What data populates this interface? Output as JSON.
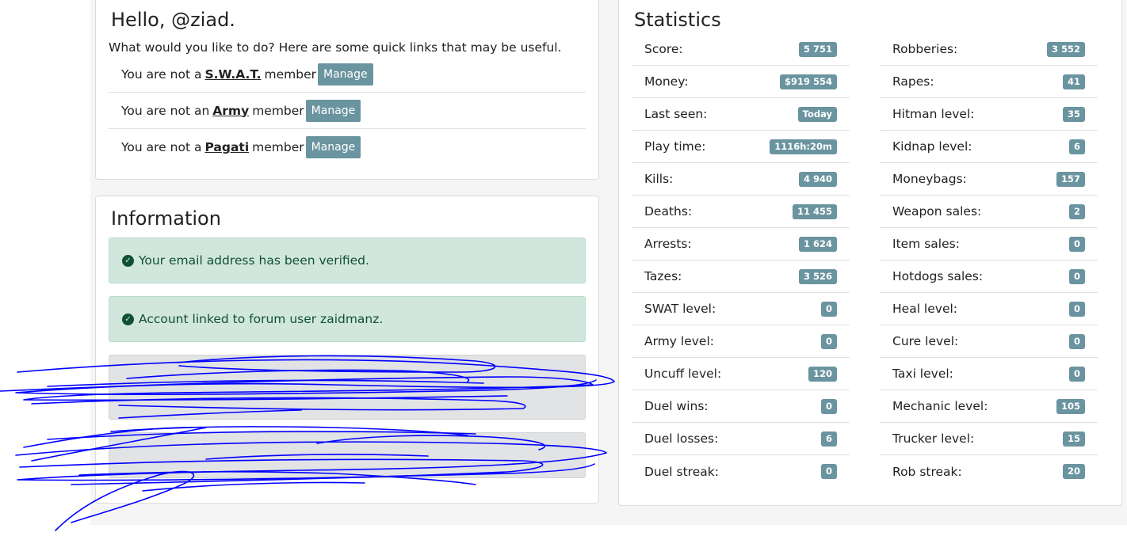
{
  "welcome": {
    "title": "Hello, @ziad.",
    "intro": "What would you like to do? Here are some quick links that may be useful.",
    "groups": [
      {
        "prefix": "You are not a",
        "name": "S.W.A.T.",
        "suffix": "member",
        "button": "Manage"
      },
      {
        "prefix": "You are not an",
        "name": "Army",
        "suffix": "member",
        "button": "Manage"
      },
      {
        "prefix": "You are not a",
        "name": "Pagati",
        "suffix": "member",
        "button": "Manage"
      }
    ]
  },
  "information": {
    "title": "Information",
    "alerts": [
      {
        "text": "Your email address has been verified.",
        "icon": "check-circle-icon"
      },
      {
        "text": "Account linked to forum user zaidmanz.",
        "icon": "check-circle-icon"
      }
    ]
  },
  "statistics": {
    "title": "Statistics",
    "left": [
      {
        "label": "Score:",
        "value": "5 751"
      },
      {
        "label": "Money:",
        "value": "$919 554"
      },
      {
        "label": "Last seen:",
        "value": "Today"
      },
      {
        "label": "Play time:",
        "value": "1116h:20m"
      },
      {
        "label": "Kills:",
        "value": "4 940"
      },
      {
        "label": "Deaths:",
        "value": "11 455"
      },
      {
        "label": "Arrests:",
        "value": "1 624"
      },
      {
        "label": "Tazes:",
        "value": "3 526"
      },
      {
        "label": "SWAT level:",
        "value": "0"
      },
      {
        "label": "Army level:",
        "value": "0"
      },
      {
        "label": "Uncuff level:",
        "value": "120"
      },
      {
        "label": "Duel wins:",
        "value": "0"
      },
      {
        "label": "Duel losses:",
        "value": "6"
      },
      {
        "label": "Duel streak:",
        "value": "0"
      }
    ],
    "right": [
      {
        "label": "Robberies:",
        "value": "3 552"
      },
      {
        "label": "Rapes:",
        "value": "41"
      },
      {
        "label": "Hitman level:",
        "value": "35"
      },
      {
        "label": "Kidnap level:",
        "value": "6"
      },
      {
        "label": "Moneybags:",
        "value": "157"
      },
      {
        "label": "Weapon sales:",
        "value": "2"
      },
      {
        "label": "Item sales:",
        "value": "0"
      },
      {
        "label": "Hotdogs sales:",
        "value": "0"
      },
      {
        "label": "Heal level:",
        "value": "0"
      },
      {
        "label": "Cure level:",
        "value": "0"
      },
      {
        "label": "Taxi level:",
        "value": "0"
      },
      {
        "label": "Mechanic level:",
        "value": "105"
      },
      {
        "label": "Trucker level:",
        "value": "15"
      },
      {
        "label": "Rob streak:",
        "value": "20"
      }
    ]
  },
  "colors": {
    "badge": "#6a949f",
    "success_bg": "#d1e7dd",
    "success_text": "#0f5132",
    "scribble": "#0000ff"
  }
}
